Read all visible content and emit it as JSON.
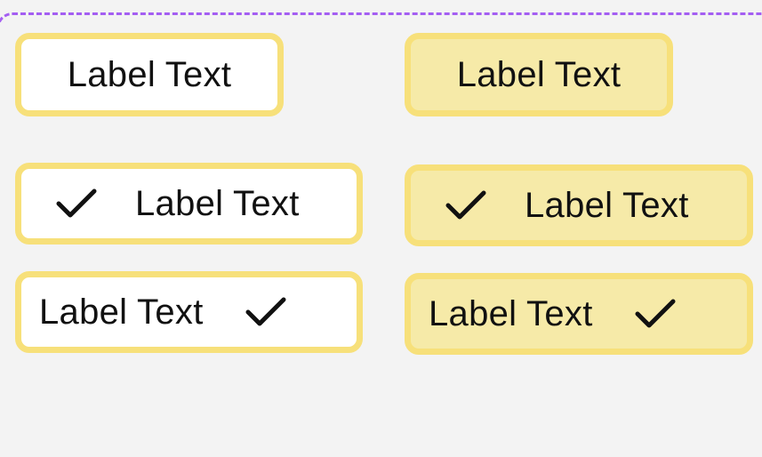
{
  "colors": {
    "dashed_border": "#a45ef2",
    "chip_border": "#f7e07a",
    "chip_fill_outline": "#ffffff",
    "chip_fill_filled": "#f6eaa8",
    "text": "#111111",
    "background": "#f3f3f3"
  },
  "chips": {
    "plain_outline": {
      "label": "Label Text"
    },
    "plain_filled": {
      "label": "Label Text"
    },
    "leading_check_outline": {
      "label": "Label Text",
      "icon": "checkmark-icon"
    },
    "leading_check_filled": {
      "label": "Label Text",
      "icon": "checkmark-icon"
    },
    "trailing_check_outline": {
      "label": "Label Text",
      "icon": "checkmark-icon"
    },
    "trailing_check_filled": {
      "label": "Label Text",
      "icon": "checkmark-icon"
    }
  }
}
